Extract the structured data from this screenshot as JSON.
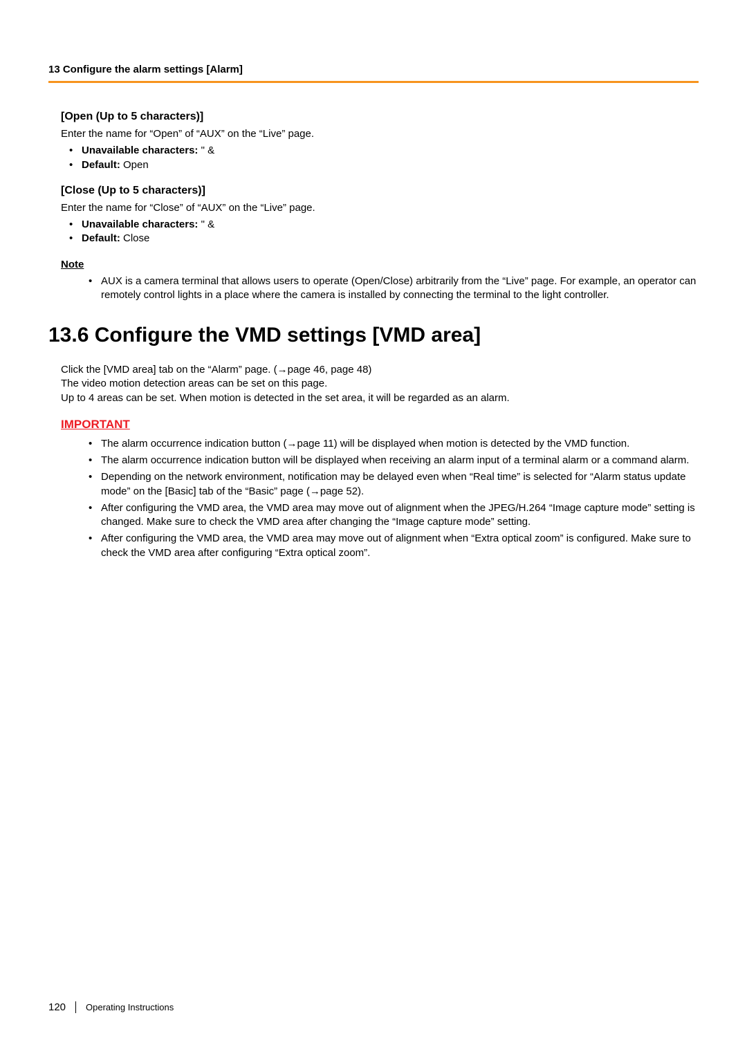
{
  "header": {
    "title": "13 Configure the alarm settings [Alarm]"
  },
  "open_section": {
    "title": "[Open (Up to 5 characters)]",
    "desc": "Enter the name for “Open” of “AUX” on the “Live” page.",
    "bullets": {
      "b1_bold": "Unavailable characters: ",
      "b1_rest": "\" &",
      "b2_bold": "Default: ",
      "b2_rest": "Open"
    }
  },
  "close_section": {
    "title": "[Close (Up to 5 characters)]",
    "desc": "Enter the name for “Close” of “AUX” on the “Live” page.",
    "bullets": {
      "b1_bold": "Unavailable characters: ",
      "b1_rest": "\" &",
      "b2_bold": "Default: ",
      "b2_rest": "Close"
    }
  },
  "note": {
    "label": "Note",
    "text": "AUX is a camera terminal that allows users to operate (Open/Close) arbitrarily from the “Live” page. For example, an operator can remotely control lights in a place where the camera is installed by connecting the terminal to the light controller."
  },
  "section_heading": "13.6  Configure the VMD settings [VMD area]",
  "intro": {
    "line1a": "Click the [VMD area] tab on the “Alarm” page. (",
    "line1b": "page 46, page 48)",
    "line2": "The video motion detection areas can be set on this page.",
    "line3": "Up to 4 areas can be set. When motion is detected in the set area, it will be regarded as an alarm."
  },
  "important": {
    "label": "IMPORTANT",
    "items": {
      "i1a": "The alarm occurrence indication button (",
      "i1b": "page 11) will be displayed when motion is detected by the VMD function.",
      "i2": "The alarm occurrence indication button will be displayed when receiving an alarm input of a terminal alarm or a command alarm.",
      "i3a": "Depending on the network environment, notification may be delayed even when “Real time” is selected for “Alarm status update mode” on the [Basic] tab of the “Basic” page (",
      "i3b": "page 52).",
      "i4": "After configuring the VMD area, the VMD area may move out of alignment when the JPEG/H.264 “Image capture mode” setting is changed. Make sure to check the VMD area after changing the “Image capture mode” setting.",
      "i5": "After configuring the VMD area, the VMD area may move out of alignment when “Extra optical zoom” is configured. Make sure to check the VMD area after configuring “Extra optical zoom”."
    }
  },
  "footer": {
    "page": "120",
    "label": "Operating Instructions"
  },
  "glyphs": {
    "arrow": "→"
  }
}
